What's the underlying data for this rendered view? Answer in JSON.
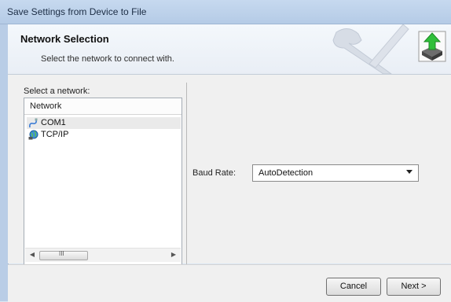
{
  "window": {
    "title": "Save Settings from Device to File"
  },
  "header": {
    "title": "Network Selection",
    "subtitle": "Select the network to connect with.",
    "icon": "download-box-icon"
  },
  "network_panel": {
    "label": "Select a network:",
    "column_header": "Network",
    "items": [
      {
        "label": "COM1",
        "icon": "serial-cable-icon",
        "selected": true
      },
      {
        "label": "TCP/IP",
        "icon": "globe-network-icon",
        "selected": false
      }
    ],
    "scroll_thumb_glyph": "III"
  },
  "settings": {
    "baud_rate_label": "Baud Rate:",
    "baud_rate_value": "AutoDetection"
  },
  "footer": {
    "cancel": "Cancel",
    "next": "Next >"
  }
}
